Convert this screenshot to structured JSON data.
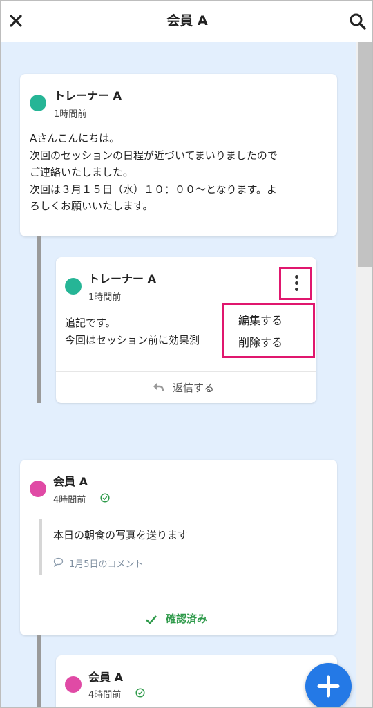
{
  "header": {
    "title": "会員 A",
    "close_icon": "close-icon",
    "search_icon": "search-icon"
  },
  "colors": {
    "content_bg": "#e3effd",
    "trainer_avatar": "#26b596",
    "member_avatar": "#e04aa5",
    "highlight": "#e0176e",
    "confirm_green": "#2e9a4a",
    "fab": "#2479e6"
  },
  "posts": [
    {
      "name": "トレーナー A",
      "time": "1時間前",
      "body": "Aさんこんにちは。\n次回のセッションの日程が近づいてまいりましたので\nご連絡いたしました。\n次回は３月１５日（水）１０：００～となります。よ\nろしくお願いいたします。"
    },
    {
      "name": "トレーナー A",
      "time": "1時間前",
      "body": "追記です。\n今回はセッション前に効果測",
      "reply_label": "返信する"
    },
    {
      "name": "会員 A",
      "time": "4時間前",
      "quote": "本日の朝食の写真を送ります",
      "comment_label": "1月5日のコメント",
      "confirm_label": "確認済み"
    },
    {
      "name": "会員 A",
      "time": "4時間前"
    }
  ],
  "menu": {
    "items": [
      "編集する",
      "削除する"
    ]
  },
  "fab": {
    "icon": "plus-icon"
  }
}
